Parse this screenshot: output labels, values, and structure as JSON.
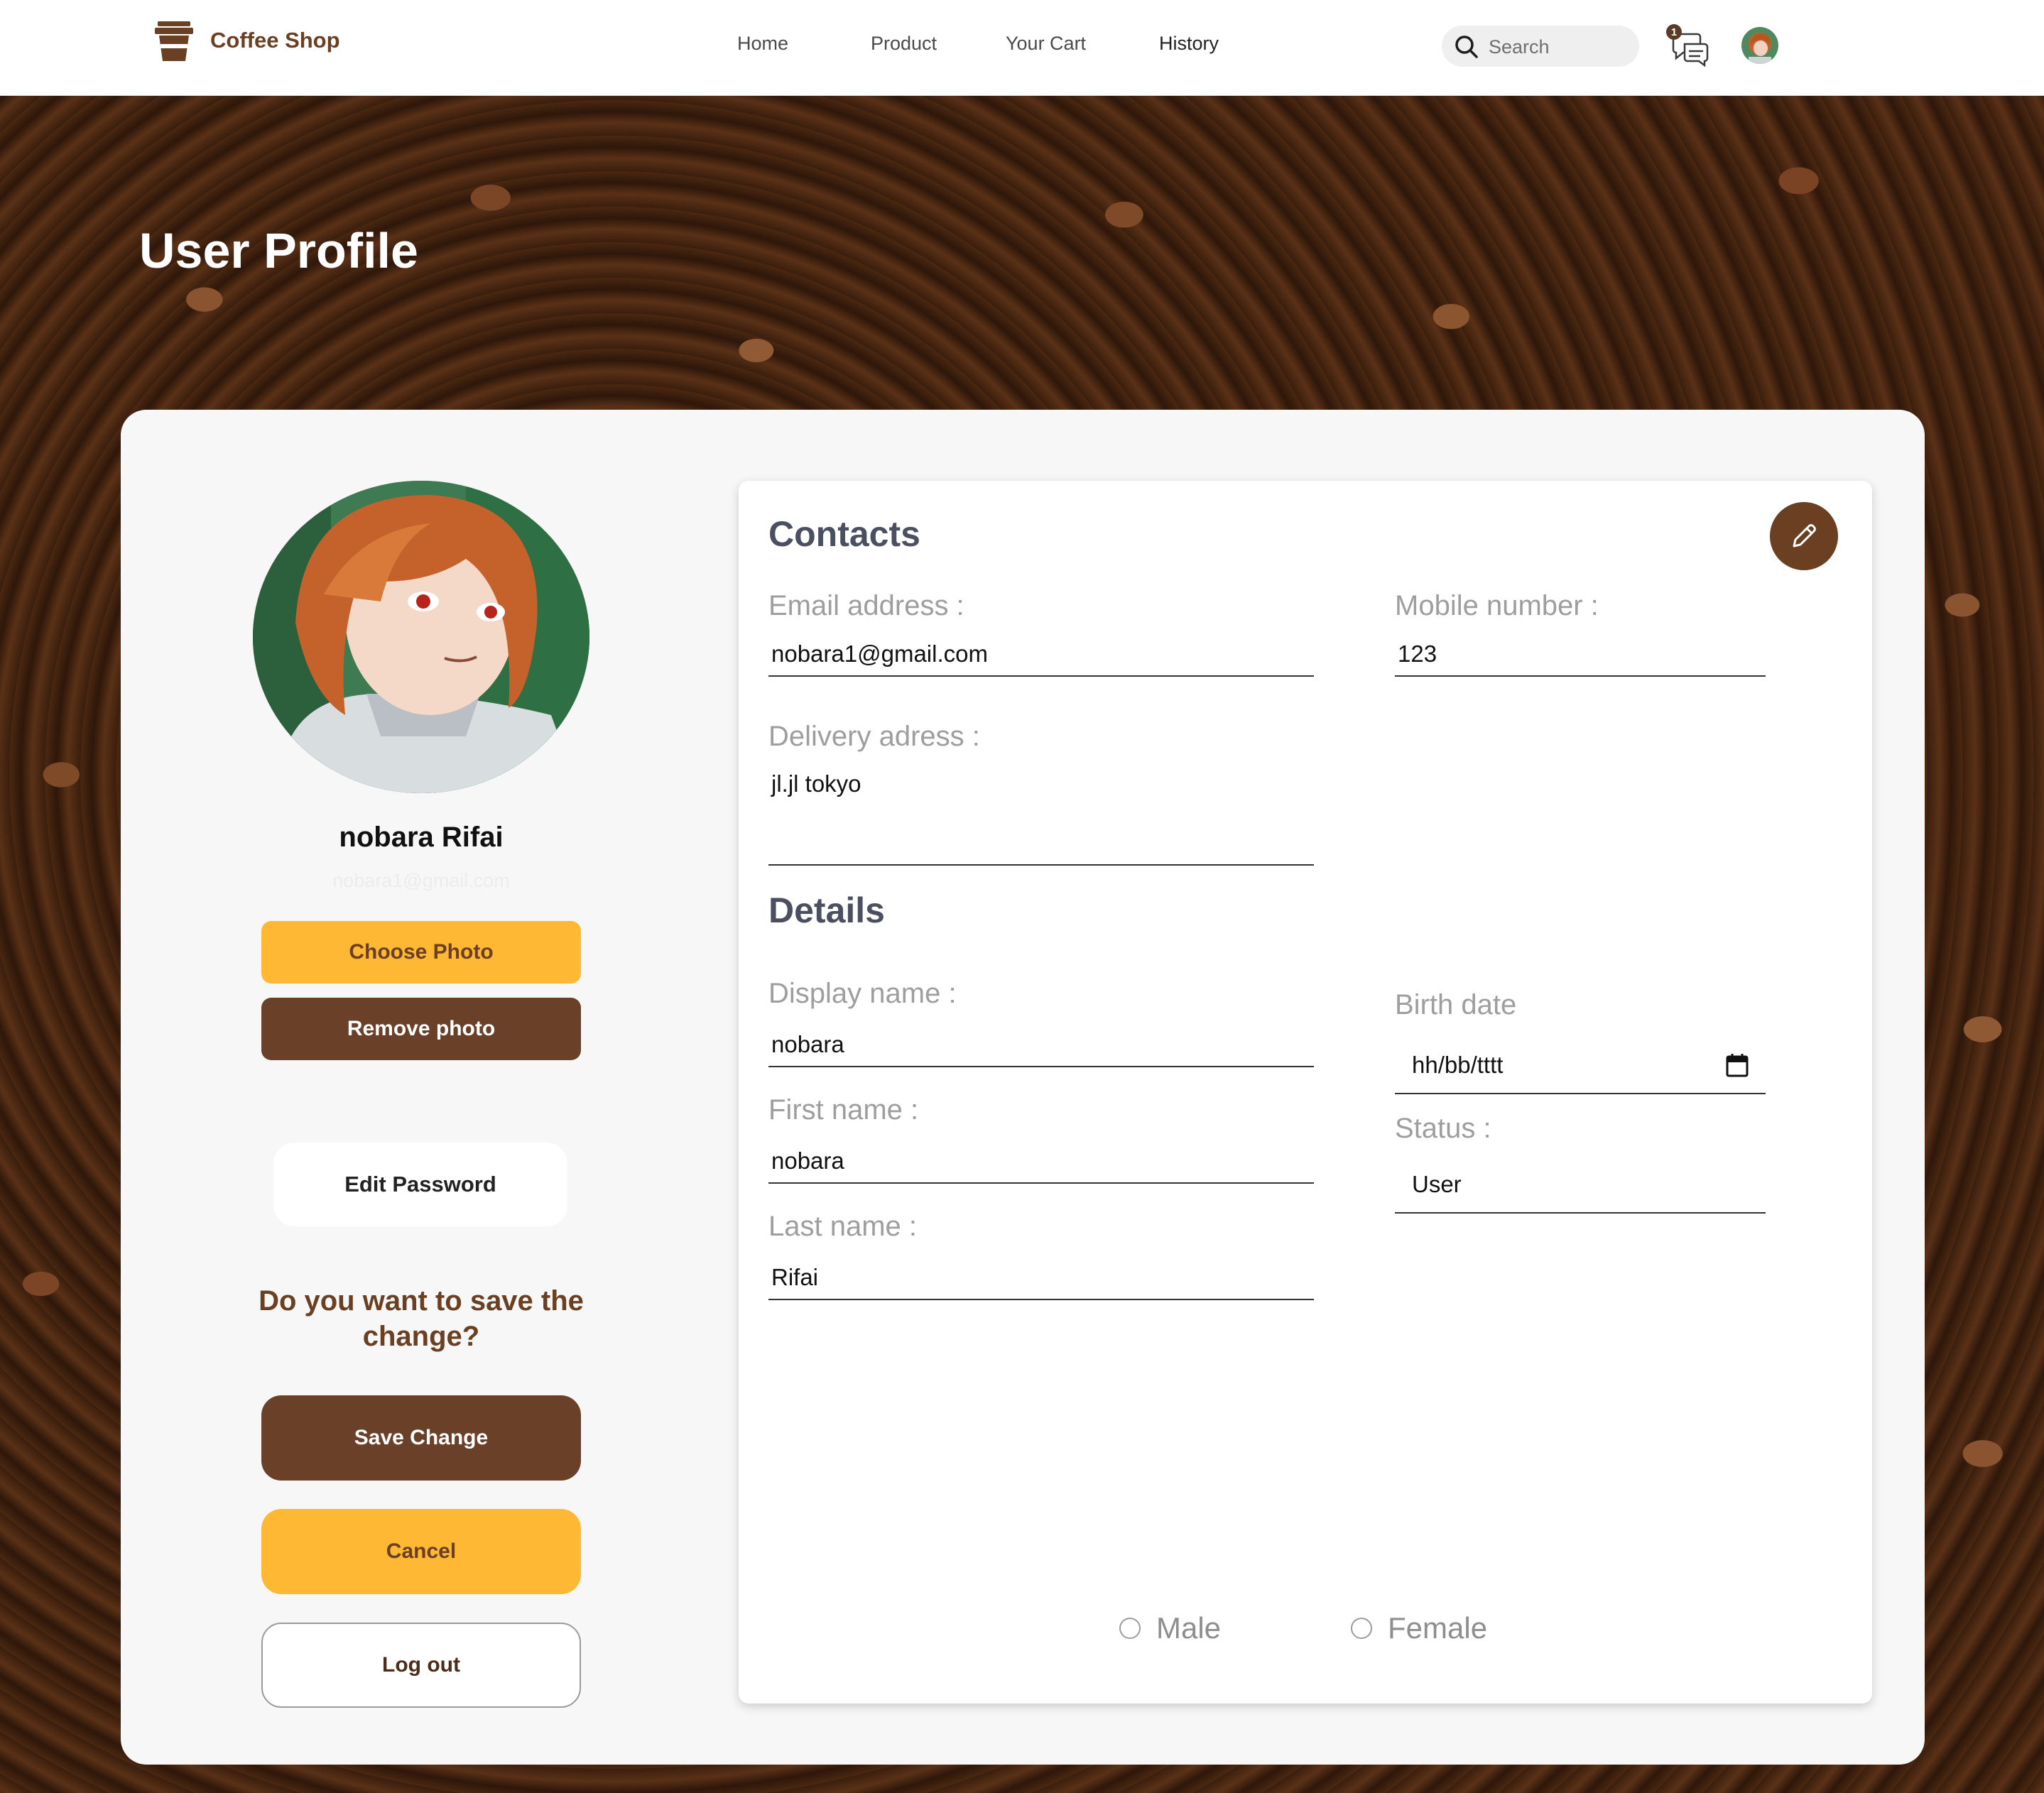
{
  "header": {
    "brand": "Coffee Shop",
    "nav": [
      {
        "label": "Home"
      },
      {
        "label": "Product"
      },
      {
        "label": "Your Cart"
      },
      {
        "label": "History"
      }
    ],
    "search_placeholder": "Search",
    "chat_badge_count": "1",
    "icons": {
      "logo": "coffee-cup-icon",
      "search": "search-icon",
      "chat": "chat-icon",
      "avatar": "user-avatar"
    }
  },
  "page": {
    "title": "User Profile"
  },
  "profile": {
    "name": "nobara Rifai",
    "email": "nobara1@gmail.com",
    "choose_photo": "Choose Photo",
    "remove_photo": "Remove photo",
    "edit_password": "Edit Password",
    "save_question": "Do you want to save the change?",
    "save_change": "Save Change",
    "cancel": "Cancel",
    "logout": "Log out"
  },
  "contacts": {
    "title": "Contacts",
    "email_label": "Email address :",
    "email_value": "nobara1@gmail.com",
    "mobile_label": "Mobile number :",
    "mobile_value": "123",
    "delivery_label": "Delivery adress :",
    "delivery_value": "jl.jl tokyo",
    "edit_icon": "pencil-icon"
  },
  "details": {
    "title": "Details",
    "display_name_label": "Display name :",
    "display_name_value": "nobara",
    "first_name_label": "First name :",
    "first_name_value": "nobara",
    "last_name_label": "Last name :",
    "last_name_value": "Rifai",
    "birth_date_label": "Birth date",
    "birth_date_placeholder": "hh/bb/tttt",
    "status_label": "Status :",
    "status_value": "User"
  },
  "gender": {
    "male": "Male",
    "female": "Female"
  },
  "colors": {
    "brand_brown": "#6a3f22",
    "button_brown": "#6a4028",
    "accent_yellow": "#ffb833",
    "label_gray": "#9e9e9e",
    "card_bg": "#f7f7f7"
  }
}
